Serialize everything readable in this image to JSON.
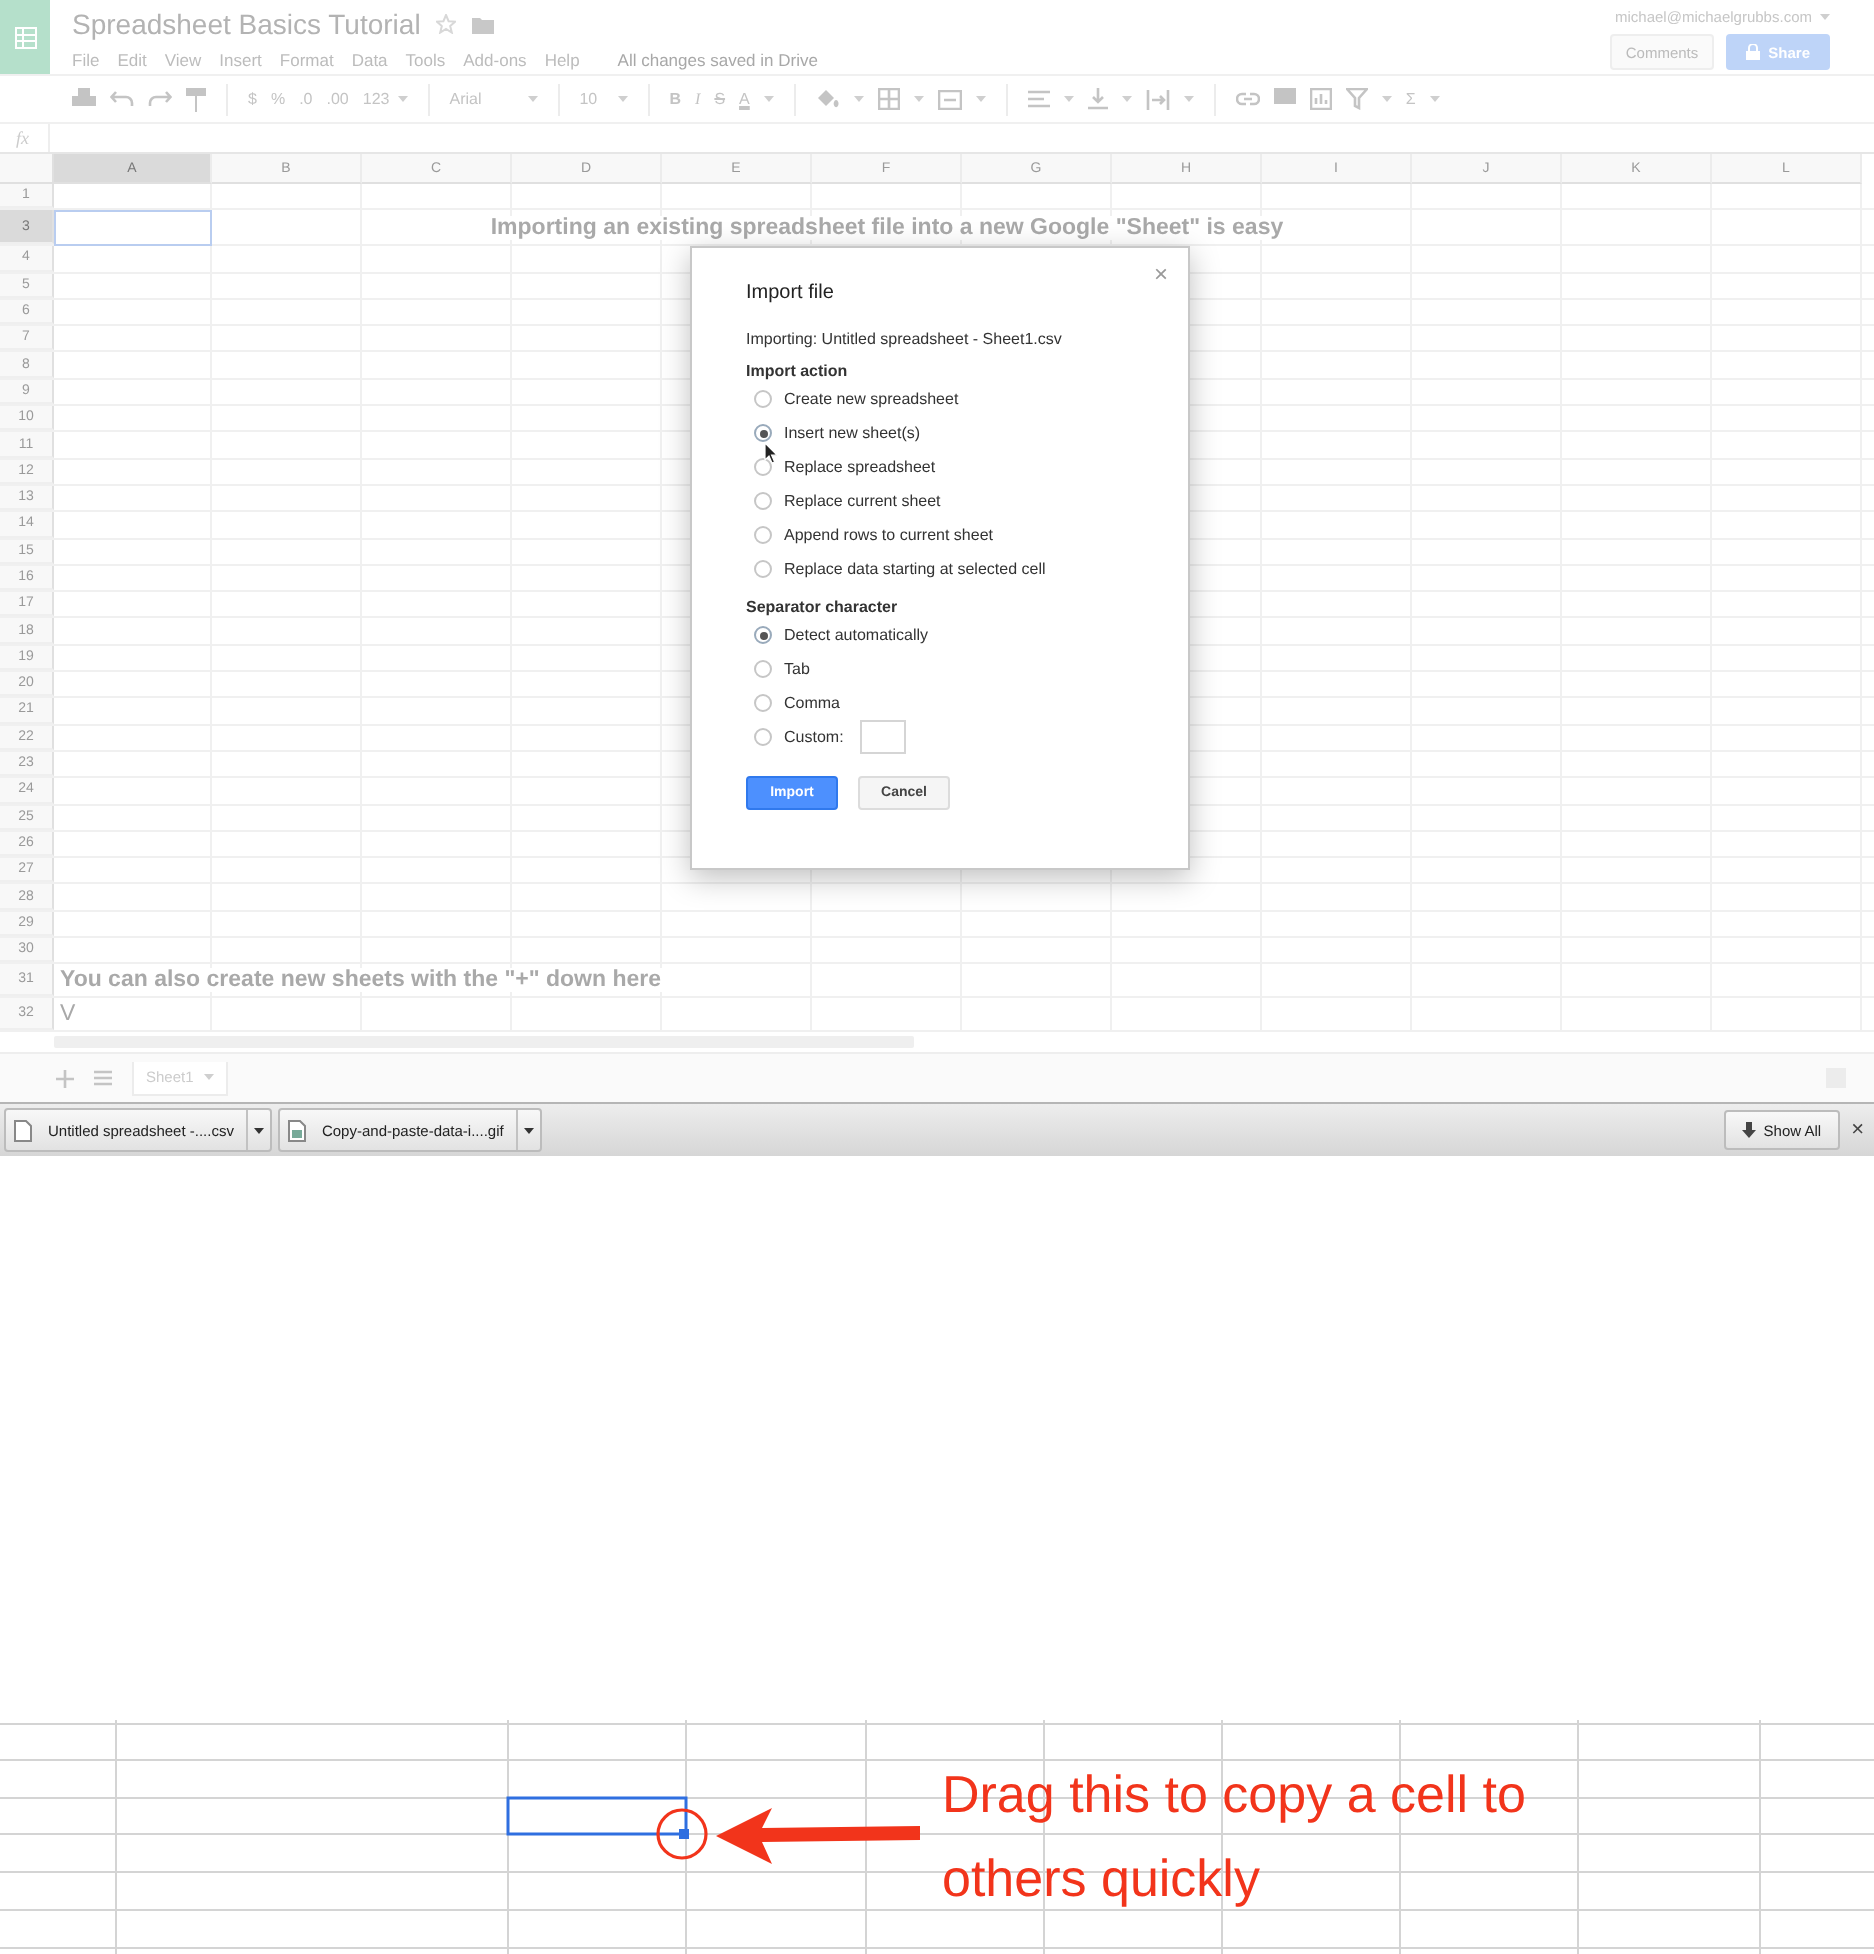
{
  "header": {
    "title": "Spreadsheet Basics Tutorial",
    "menu": [
      "File",
      "Edit",
      "View",
      "Insert",
      "Format",
      "Data",
      "Tools",
      "Add-ons",
      "Help"
    ],
    "status": "All changes saved in Drive",
    "account": "michael@michaelgrubbs.com",
    "comments": "Comments",
    "share": "Share"
  },
  "toolbar": {
    "currency": "$",
    "percent": "%",
    "decimal_less": ".0",
    "decimal_more": ".00",
    "number_format": "123",
    "font": "Arial",
    "font_size": "10",
    "bold": "B",
    "italic": "I",
    "strikethrough": "S",
    "text_color": "A",
    "functions": "Σ"
  },
  "formula_bar": {
    "label": "fx"
  },
  "columns": [
    {
      "label": "A",
      "selected": true
    },
    {
      "label": "B",
      "selected": false
    },
    {
      "label": "C",
      "selected": false
    },
    {
      "label": "D",
      "selected": false
    },
    {
      "label": "E",
      "selected": false
    },
    {
      "label": "F",
      "selected": false
    },
    {
      "label": "G",
      "selected": false
    },
    {
      "label": "H",
      "selected": false
    },
    {
      "label": "I",
      "selected": false
    },
    {
      "label": "J",
      "selected": false
    },
    {
      "label": "K",
      "selected": false
    },
    {
      "label": "L",
      "selected": false
    }
  ],
  "rows": [
    {
      "number": "1",
      "selected": false,
      "kind": "empty"
    },
    {
      "number": "3",
      "selected": true,
      "kind": "heading",
      "text": "Importing an existing spreadsheet file into a new Google \"Sheet\" is easy"
    },
    {
      "number": "4",
      "selected": false,
      "kind": "empty"
    },
    {
      "number": "5",
      "selected": false,
      "kind": "empty"
    },
    {
      "number": "6",
      "selected": false,
      "kind": "empty"
    },
    {
      "number": "7",
      "selected": false,
      "kind": "empty"
    },
    {
      "number": "8",
      "selected": false,
      "kind": "empty"
    },
    {
      "number": "9",
      "selected": false,
      "kind": "empty"
    },
    {
      "number": "10",
      "selected": false,
      "kind": "empty"
    },
    {
      "number": "11",
      "selected": false,
      "kind": "empty"
    },
    {
      "number": "12",
      "selected": false,
      "kind": "empty"
    },
    {
      "number": "13",
      "selected": false,
      "kind": "empty"
    },
    {
      "number": "14",
      "selected": false,
      "kind": "empty"
    },
    {
      "number": "15",
      "selected": false,
      "kind": "empty"
    },
    {
      "number": "16",
      "selected": false,
      "kind": "empty"
    },
    {
      "number": "17",
      "selected": false,
      "kind": "empty"
    },
    {
      "number": "18",
      "selected": false,
      "kind": "empty"
    },
    {
      "number": "19",
      "selected": false,
      "kind": "empty"
    },
    {
      "number": "20",
      "selected": false,
      "kind": "empty"
    },
    {
      "number": "21",
      "selected": false,
      "kind": "empty"
    },
    {
      "number": "22",
      "selected": false,
      "kind": "empty"
    },
    {
      "number": "23",
      "selected": false,
      "kind": "empty"
    },
    {
      "number": "24",
      "selected": false,
      "kind": "empty"
    },
    {
      "number": "25",
      "selected": false,
      "kind": "empty"
    },
    {
      "number": "26",
      "selected": false,
      "kind": "empty"
    },
    {
      "number": "27",
      "selected": false,
      "kind": "empty"
    },
    {
      "number": "28",
      "selected": false,
      "kind": "empty"
    },
    {
      "number": "29",
      "selected": false,
      "kind": "empty"
    },
    {
      "number": "30",
      "selected": false,
      "kind": "empty"
    },
    {
      "number": "31",
      "selected": false,
      "kind": "note",
      "text": "You can also create new sheets with the \"+\" down here"
    },
    {
      "number": "32",
      "selected": false,
      "kind": "plain",
      "text": "V"
    }
  ],
  "dialog": {
    "title": "Import file",
    "close": "×",
    "file_line": "Importing: Untitled spreadsheet - Sheet1.csv",
    "sections": [
      {
        "heading": "Import action",
        "options": [
          {
            "label": "Create new spreadsheet",
            "selected": false,
            "kind": "plain"
          },
          {
            "label": "Insert new sheet(s)",
            "selected": true,
            "kind": "plain"
          },
          {
            "label": "Replace spreadsheet",
            "selected": false,
            "kind": "plain"
          },
          {
            "label": "Replace current sheet",
            "selected": false,
            "kind": "plain"
          },
          {
            "label": "Append rows to current sheet",
            "selected": false,
            "kind": "plain"
          },
          {
            "label": "Replace data starting at selected cell",
            "selected": false,
            "kind": "plain"
          }
        ]
      },
      {
        "heading": "Separator character",
        "options": [
          {
            "label": "Detect automatically",
            "selected": true,
            "kind": "plain"
          },
          {
            "label": "Tab",
            "selected": false,
            "kind": "plain"
          },
          {
            "label": "Comma",
            "selected": false,
            "kind": "plain"
          },
          {
            "label": "Custom:",
            "selected": false,
            "kind": "custom"
          }
        ]
      }
    ],
    "buttons": [
      {
        "label": "Import",
        "primary": true
      },
      {
        "label": "Cancel",
        "primary": false
      }
    ]
  },
  "sheet_tabs": [
    {
      "label": "Sheet1",
      "selected": true
    }
  ],
  "downloads": {
    "items": [
      {
        "name": "Untitled spreadsheet -....csv",
        "kind": "csv"
      },
      {
        "name": "Copy-and-paste-data-i....gif",
        "kind": "gif"
      }
    ],
    "show_all": "Show All",
    "close": "×"
  },
  "example": {
    "annotation": "Drag this to copy a cell to others quickly"
  }
}
